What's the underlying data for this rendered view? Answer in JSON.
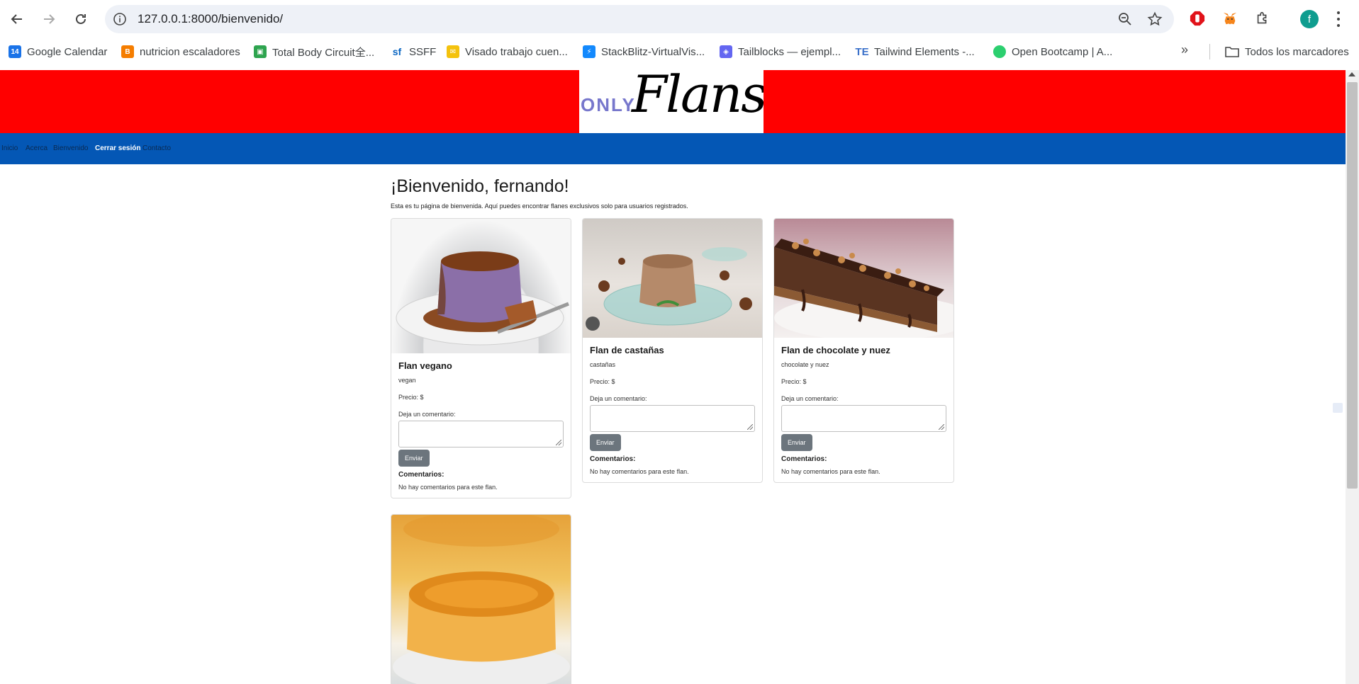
{
  "browser": {
    "url": "127.0.0.1:8000/bienvenido/",
    "avatar_letter": "f",
    "bookmarks": [
      {
        "label": "Google Calendar",
        "icon": "calendar-icon",
        "color": "#1a73e8"
      },
      {
        "label": "nutricion escaladores",
        "icon": "blogger-icon",
        "color": "#f57d00"
      },
      {
        "label": "Total Body Circuit全...",
        "icon": "tablet-icon",
        "color": "#2ea44f"
      },
      {
        "label": "SSFF",
        "icon": "sf-icon",
        "color": "#0a66c2"
      },
      {
        "label": "Visado trabajo cuen...",
        "icon": "mail-icon",
        "color": "#f4c20d"
      },
      {
        "label": "StackBlitz-VirtualVis...",
        "icon": "bolt-icon",
        "color": "#1389fd"
      },
      {
        "label": "Tailblocks — ejempl...",
        "icon": "blocks-icon",
        "color": "#6366f1"
      },
      {
        "label": "Tailwind Elements -...",
        "icon": "te-icon",
        "color": "#3b71ca"
      },
      {
        "label": "Open Bootcamp | A...",
        "icon": "ob-icon",
        "color": "#2ccf6f"
      }
    ],
    "more": "»",
    "all_bookmarks": "Todos los marcadores"
  },
  "site": {
    "logo_only": "ONLY",
    "logo_flans": "Flans",
    "nav": [
      {
        "label": "Inicio",
        "active": false
      },
      {
        "label": "Acerca",
        "active": false
      },
      {
        "label": "Bienvenido",
        "active": false
      },
      {
        "label": "Cerrar sesión",
        "active": true
      },
      {
        "label": "Contacto",
        "active": false
      }
    ],
    "colors": {
      "header": "#ff0000",
      "navbar": "#0457b5",
      "button": "#6c757d"
    }
  },
  "main": {
    "title": "¡Bienvenido, fernando!",
    "lead": "Esta es tu página de bienvenida. Aquí puedes encontrar flanes exclusivos solo para usuarios registrados.",
    "comment_label": "Deja un comentario:",
    "submit_label": "Enviar",
    "comments_title": "Comentarios:",
    "no_comments": "No hay comentarios para este flan.",
    "price_label": "Precio: $",
    "cards": [
      {
        "name": "Flan vegano",
        "description": "vegan"
      },
      {
        "name": "Flan de castañas",
        "description": "castañas"
      },
      {
        "name": "Flan de chocolate y nuez",
        "description": "chocolate y nuez"
      },
      {
        "name": "",
        "description": ""
      }
    ]
  }
}
